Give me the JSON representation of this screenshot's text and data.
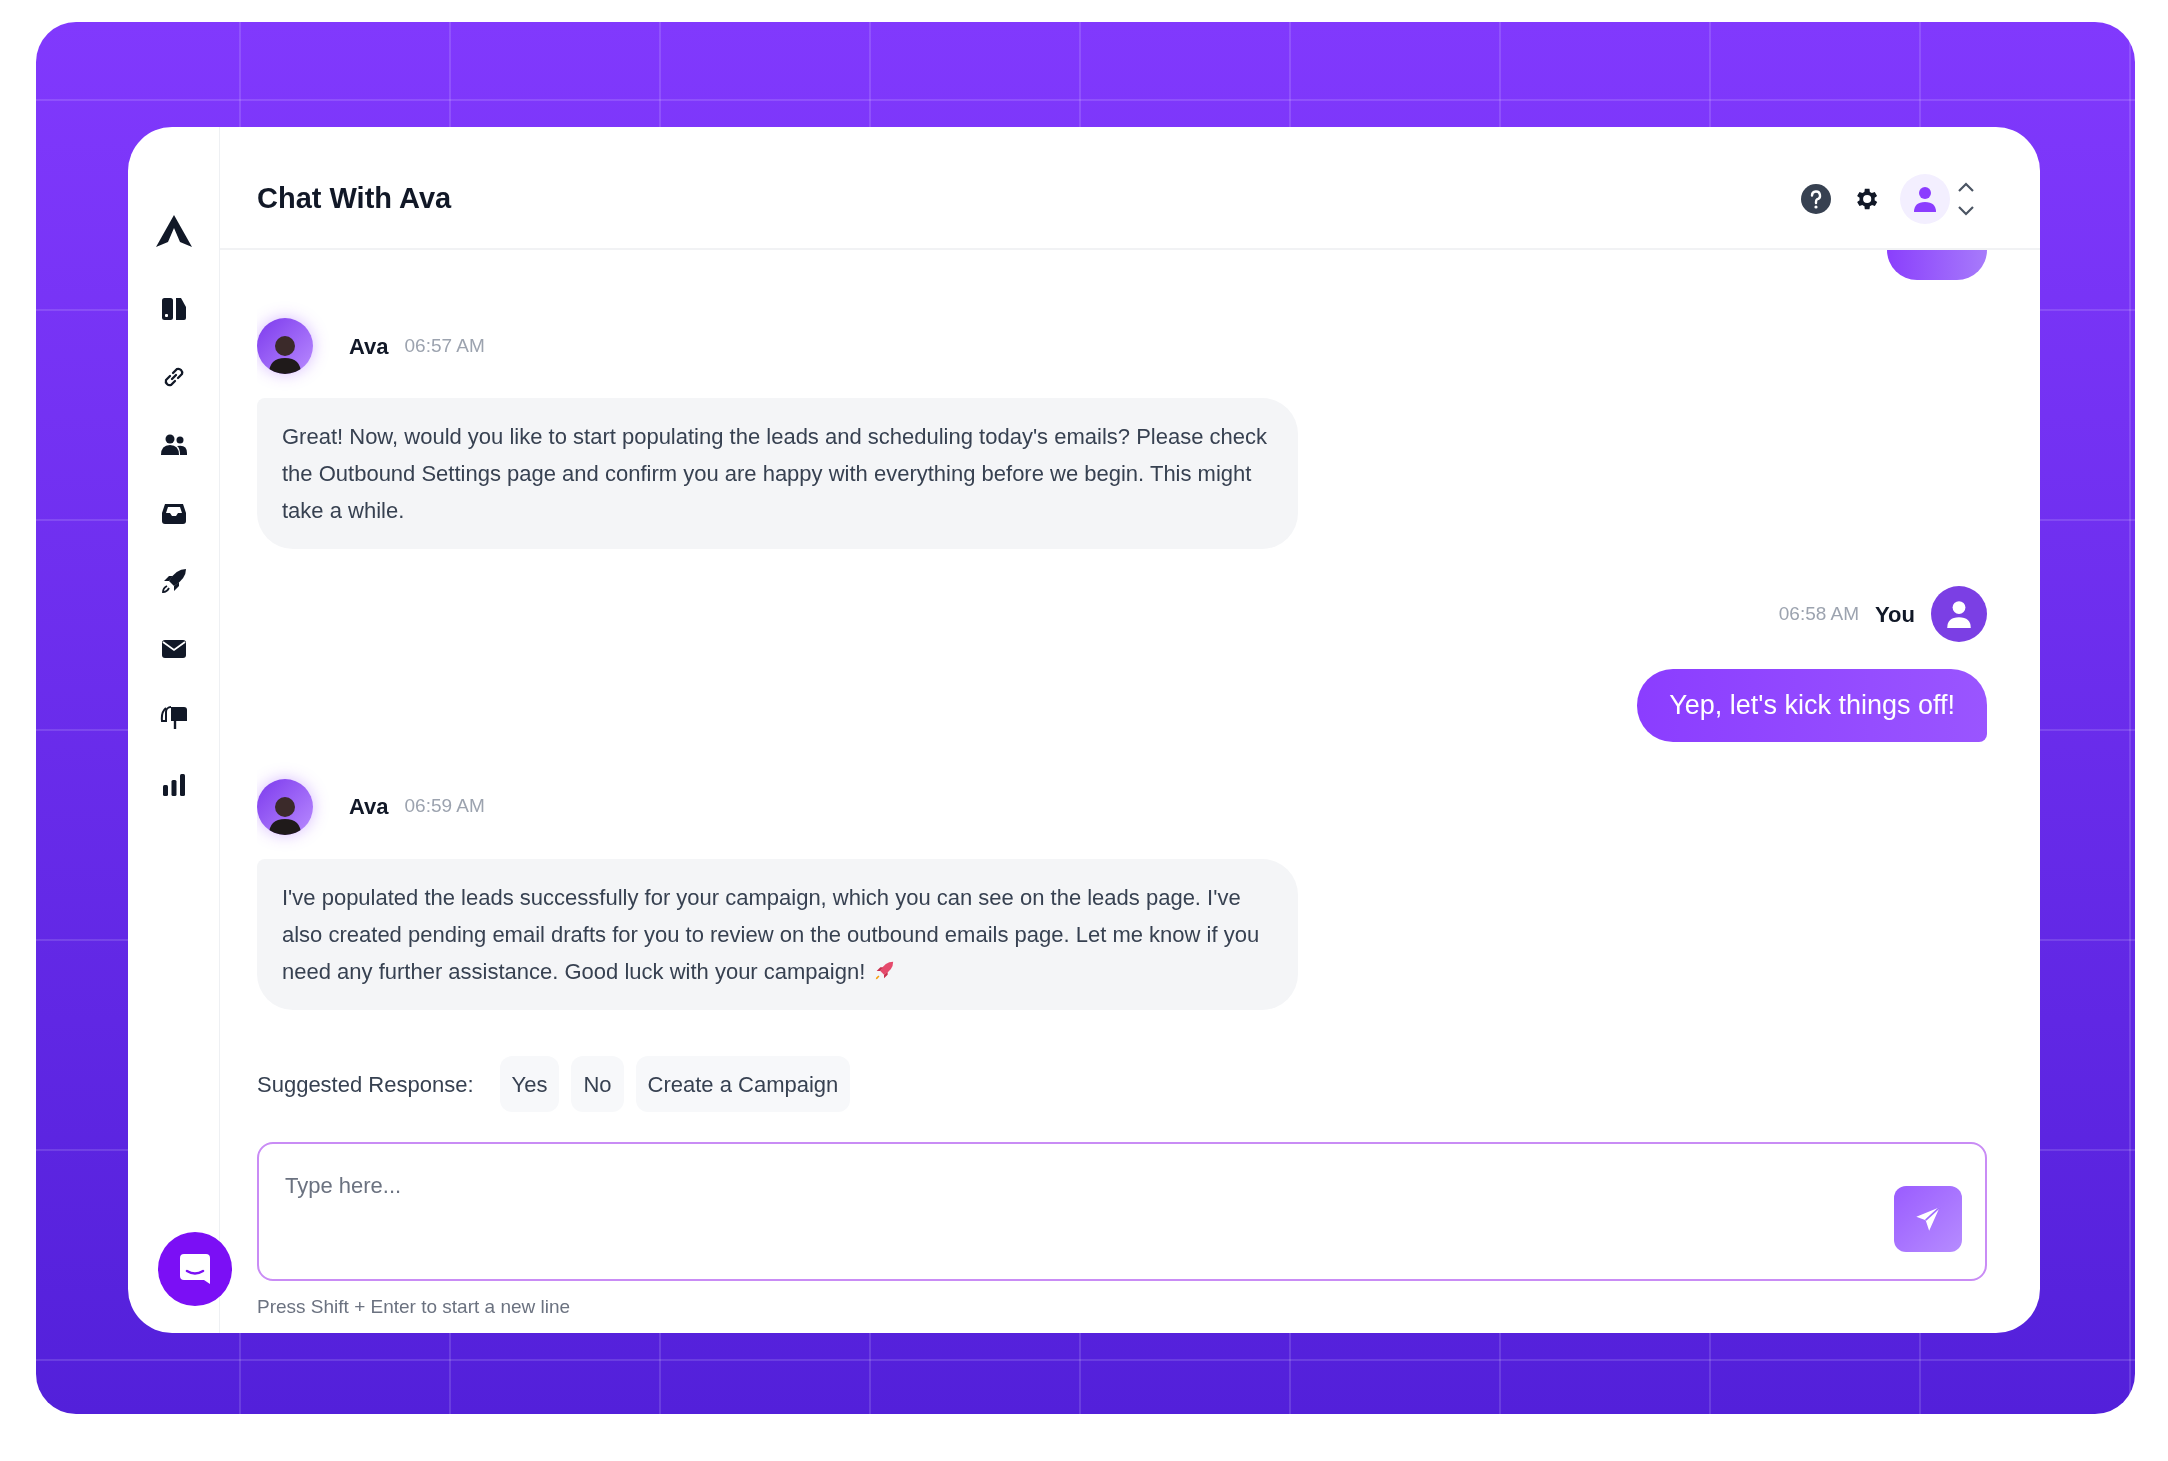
{
  "header": {
    "title": "Chat With Ava"
  },
  "messages": [
    {
      "kind": "assistant",
      "sender": "Ava",
      "time": "06:57 AM",
      "text": "Great! Now, would you like to start populating the leads and scheduling today's emails? Please check the Outbound Settings page and confirm you are happy with everything before we begin. This might take a while."
    },
    {
      "kind": "user",
      "sender": "You",
      "time": "06:58 AM",
      "text": "Yep, let's kick things off!"
    },
    {
      "kind": "assistant",
      "sender": "Ava",
      "time": "06:59 AM",
      "text": "I've populated the leads successfully for your campaign, which you can see on the leads page. I've also created pending email drafts for you to review on the outbound emails page. Let me know if you need any further assistance. Good luck with your campaign!",
      "emoji": true
    }
  ],
  "suggested": {
    "label": "Suggested Response:",
    "options": [
      "Yes",
      "No",
      "Create a Campaign"
    ]
  },
  "composer": {
    "placeholder": "Type here...",
    "hint": "Press Shift + Enter to start a new line"
  }
}
